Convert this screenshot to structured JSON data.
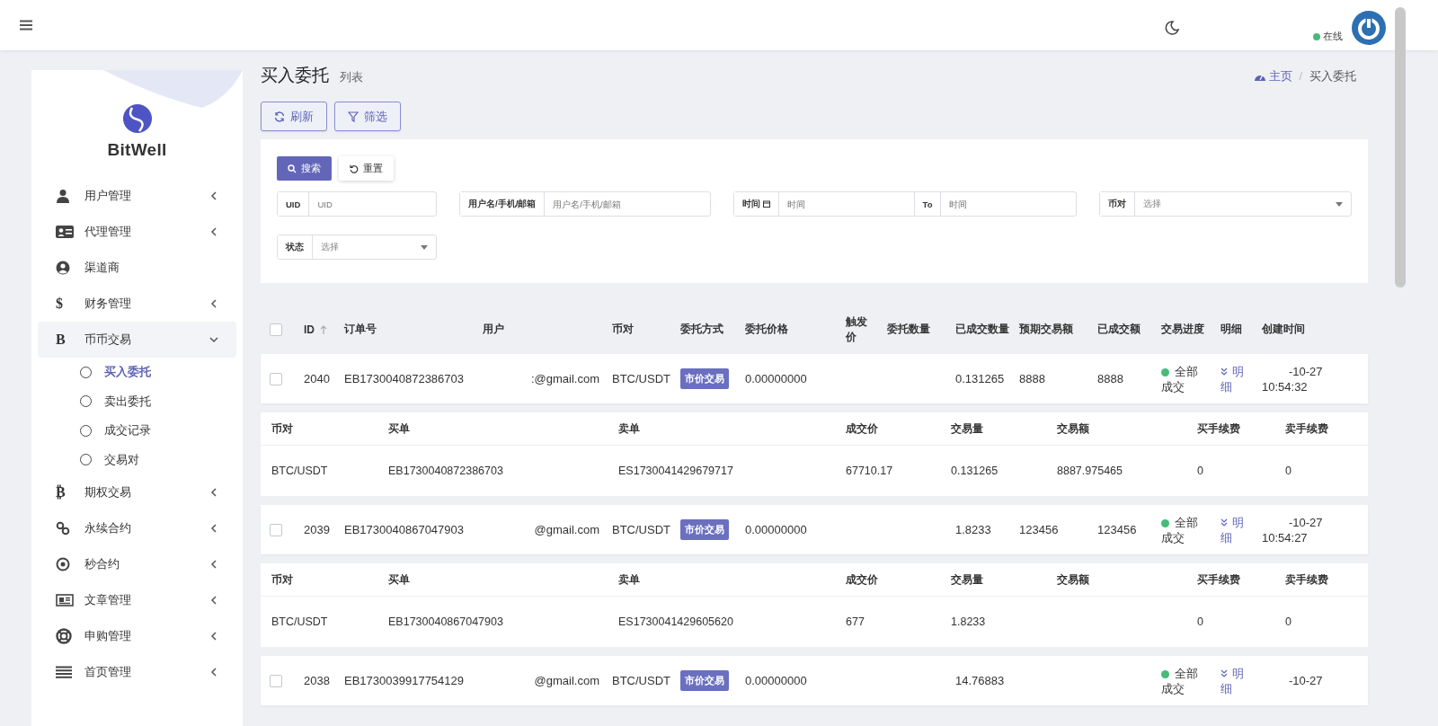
{
  "header": {
    "status": {
      "label": "在线",
      "color": "#48bb78"
    }
  },
  "sidebar": {
    "brand": "BitWell",
    "items": [
      {
        "label": "用户管理",
        "expandable": true,
        "expanded": false,
        "selected": false
      },
      {
        "label": "代理管理",
        "expandable": true,
        "expanded": false,
        "selected": false
      },
      {
        "label": "渠道商",
        "expandable": false,
        "expanded": false,
        "selected": false
      },
      {
        "label": "财务管理",
        "glyph": "$",
        "expandable": true,
        "expanded": false,
        "selected": false
      },
      {
        "label": "币币交易",
        "glyph": "B",
        "expandable": true,
        "expanded": true,
        "selected": true,
        "children": [
          {
            "label": "买入委托",
            "selected": true
          },
          {
            "label": "卖出委托",
            "selected": false
          },
          {
            "label": "成交记录",
            "selected": false
          },
          {
            "label": "交易对",
            "selected": false
          }
        ]
      },
      {
        "label": "期权交易",
        "glyph": "₿",
        "expandable": true,
        "expanded": false,
        "selected": false
      },
      {
        "label": "永续合约",
        "expandable": true,
        "expanded": false,
        "selected": false
      },
      {
        "label": "秒合约",
        "expandable": true,
        "expanded": false,
        "selected": false
      },
      {
        "label": "文章管理",
        "expandable": true,
        "expanded": false,
        "selected": false
      },
      {
        "label": "申购管理",
        "expandable": true,
        "expanded": false,
        "selected": false
      },
      {
        "label": "首页管理",
        "expandable": true,
        "expanded": false,
        "selected": false
      }
    ]
  },
  "page": {
    "title": "买入委托",
    "subtitle": "列表",
    "breadcrumb": [
      "主页",
      "买入委托"
    ],
    "breadcrumb_separator": "/"
  },
  "toolbar": [
    "刷新",
    "筛选"
  ],
  "filters": {
    "search_button": "搜索",
    "reset_button": "重置",
    "fields": [
      {
        "kind": "text",
        "label": "UID",
        "placeholder": "UID"
      },
      {
        "kind": "text",
        "label": "用户名/手机/邮箱",
        "placeholder": "用户名/手机/邮箱"
      },
      {
        "kind": "range",
        "label": "时间",
        "placeholder": "时间",
        "separator": "To",
        "placeholder_end": "时间"
      },
      {
        "kind": "select",
        "label": "币对",
        "placeholder": "选择"
      },
      {
        "kind": "select",
        "label": "状态",
        "placeholder": "选择"
      }
    ]
  },
  "table": {
    "select_all_checked": false,
    "columns": [
      {
        "label": "ID",
        "sortable": true
      },
      {
        "label": "订单号"
      },
      {
        "label": "用户"
      },
      {
        "label": "币对"
      },
      {
        "label": "委托方式"
      },
      {
        "label": "委托价格"
      },
      {
        "label": "触发价"
      },
      {
        "label": "委托数量"
      },
      {
        "label": "已成交数量"
      },
      {
        "label": "预期交易额"
      },
      {
        "label": "已成交额"
      },
      {
        "label": "交易进度"
      },
      {
        "label": "明细"
      },
      {
        "label": "创建时间"
      }
    ],
    "rows": [
      {
        "checked": false,
        "id": "2040",
        "order_no": "EB1730040872386703",
        "user": ":@gmail.com",
        "pair": "BTC/USDT",
        "type": "市价交易",
        "price": "0.00000000",
        "filled_qty": "0.131265",
        "expected_amount": "8888",
        "filled_amount": "8888",
        "progress": "全部成交",
        "color": "#48bb78",
        "detail": "明细",
        "date": "-10-27",
        "time": "10:54:32",
        "trades": [
          {
            "columns": [
              "币对",
              "买单",
              "卖单",
              "成交价",
              "交易量",
              "交易额",
              "买手续费",
              "卖手续费"
            ],
            "pair": "BTC/USDT",
            "buy_order": "EB1730040872386703",
            "sell_order": "ES1730041429679717",
            "price": "67710.17",
            "qty": "0.131265",
            "amount": "8887.975465",
            "buy_fee": "0",
            "sell_fee": "0"
          }
        ]
      },
      {
        "checked": false,
        "id": "2039",
        "order_no": "EB1730040867047903",
        "user": "@gmail.com",
        "pair": "BTC/USDT",
        "type": "市价交易",
        "price": "0.00000000",
        "filled_qty": "1.8233",
        "expected_amount": "123456",
        "filled_amount": "123456",
        "progress": "全部成交",
        "color": "#48bb78",
        "detail": "明细",
        "date": "-10-27",
        "time": "10:54:27",
        "trades": [
          {
            "columns": [
              "币对",
              "买单",
              "卖单",
              "成交价",
              "交易量",
              "交易额",
              "买手续费",
              "卖手续费"
            ],
            "pair": "BTC/USDT",
            "buy_order": "EB1730040867047903",
            "sell_order": "ES1730041429605620",
            "price": "677",
            "qty": "1.8233",
            "buy_fee": "0",
            "sell_fee": "0"
          }
        ]
      },
      {
        "checked": false,
        "id": "2038",
        "order_no": "EB1730039917754129",
        "user": "@gmail.com",
        "pair": "BTC/USDT",
        "type": "市价交易",
        "price": "0.00000000",
        "filled_qty": "14.76883",
        "progress": "全部成交",
        "color": "#48bb78",
        "detail": "明细",
        "date": "-10-27"
      }
    ]
  }
}
